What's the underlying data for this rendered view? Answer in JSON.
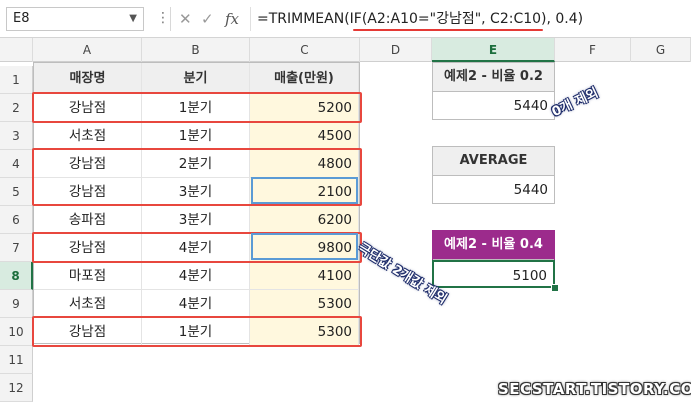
{
  "formula_bar": {
    "name_box": "E8",
    "name_box_chevron": "chevron-down-icon",
    "more_icon": "⋮",
    "cancel_icon": "✕",
    "enter_icon": "✓",
    "fx_label": "fx",
    "formula_prefix": "=TRIMMEAN(",
    "formula_highlight": "IF(A2:A10=\"강남점\", C2:C10)",
    "formula_suffix": ", 0.4)"
  },
  "columns": [
    "A",
    "B",
    "C",
    "D",
    "E",
    "F",
    "G"
  ],
  "selected_column": "E",
  "rows": [
    "1",
    "2",
    "3",
    "4",
    "5",
    "6",
    "7",
    "8",
    "9",
    "10",
    "11",
    "12"
  ],
  "selected_row": "8",
  "table": {
    "headers": [
      "매장명",
      "분기",
      "매출(만원)"
    ],
    "data": [
      [
        "강남점",
        "1분기",
        "5200"
      ],
      [
        "서초점",
        "1분기",
        "4500"
      ],
      [
        "강남점",
        "2분기",
        "4800"
      ],
      [
        "강남점",
        "3분기",
        "2100"
      ],
      [
        "송파점",
        "3분기",
        "6200"
      ],
      [
        "강남점",
        "4분기",
        "9800"
      ],
      [
        "마포점",
        "4분기",
        "4100"
      ],
      [
        "서초점",
        "4분기",
        "5300"
      ],
      [
        "강남점",
        "1분기",
        "5300"
      ]
    ]
  },
  "example1": {
    "header": "예제2 - 비율 0.2",
    "value": "5440"
  },
  "average": {
    "header": "AVERAGE",
    "value": "5440"
  },
  "example2": {
    "header": "예제2 - 비율 0.4",
    "value": "5100"
  },
  "annotations": {
    "zero_excluded": "0개 제외",
    "extremes_excluded": "극단값 2개값 제외"
  },
  "watermark": "SECSTART.TISTORY.COM",
  "colors": {
    "highlight_red": "#e8473e",
    "highlight_blue": "#5b9bd5",
    "sales_fill": "#fff8de",
    "purple_header": "#9c2b8c",
    "excel_green": "#217346"
  }
}
